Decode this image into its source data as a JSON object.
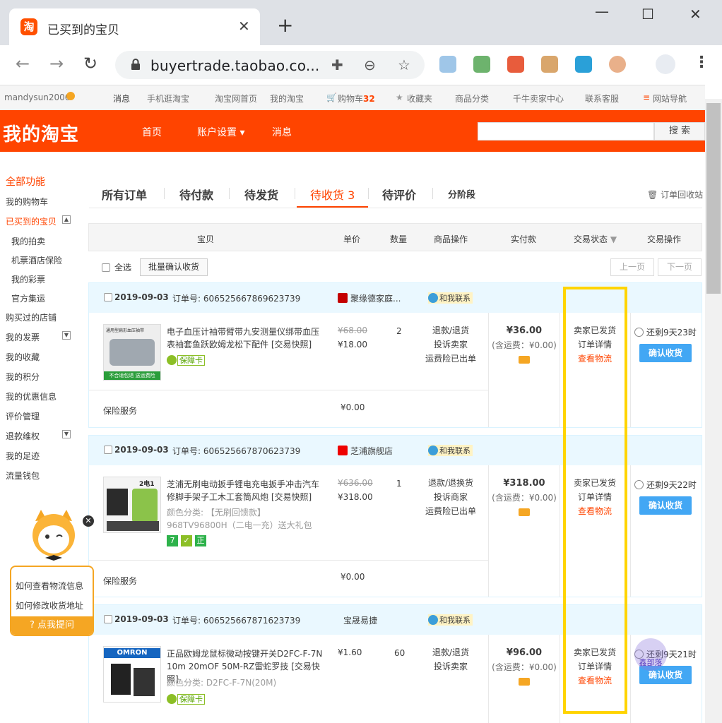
{
  "browser": {
    "tab_title": "已买到的宝贝",
    "favicon_text": "淘",
    "url": "buyertrade.taobao.co..."
  },
  "sitenav": {
    "user": "mandysun2006",
    "message": "消息",
    "mobile": "手机逛淘宝",
    "home": "淘宝网首页",
    "my": "我的淘宝",
    "cart": "购物车",
    "cart_count": "32",
    "fav": "收藏夹",
    "category": "商品分类",
    "seller": "千牛卖家中心",
    "service": "联系客服",
    "sitemap": "网站导航"
  },
  "header": {
    "logo": "我的淘宝",
    "nav": [
      "首页",
      "账户设置",
      "消息"
    ],
    "search_btn": "搜 索"
  },
  "sidebar": {
    "all": "全部功能",
    "cart": "我的购物车",
    "bought": "已买到的宝贝",
    "sub": [
      "我的拍卖",
      "机票酒店保险",
      "我的彩票",
      "官方集运"
    ],
    "items": [
      "购买过的店铺",
      "我的发票",
      "我的收藏",
      "我的积分",
      "我的优惠信息",
      "评价管理",
      "退款维权",
      "我的足迹",
      "流量钱包"
    ]
  },
  "tabs": {
    "all": "所有订单",
    "pay": "待付款",
    "ship": "待发货",
    "receive": "待收货",
    "receive_count": "3",
    "review": "待评价",
    "stage": "分阶段",
    "recycle": "订单回收站"
  },
  "columns": {
    "item": "宝贝",
    "price": "单价",
    "qty": "数量",
    "ops": "商品操作",
    "paid": "实付款",
    "status": "交易状态",
    "action": "交易操作"
  },
  "toolbar": {
    "select_all": "全选",
    "batch": "批量确认收货",
    "prev": "上一页",
    "next": "下一页"
  },
  "orders": [
    {
      "date": "2019-09-03",
      "order_no": "订单号: 606525667869623739",
      "shop": "聚缘德家庭...",
      "contact": "和我联系",
      "img_text": "通用型扁形血压袖带",
      "img_footer": "不合适包退 送运费险",
      "title": "电子血压计袖带臂带九安测量仪绑带血压表袖套鱼跃欧姆龙松下配件 [交易快照]",
      "attr": "",
      "badge": "保障卡",
      "orig_price": "¥68.00",
      "price": "¥18.00",
      "qty": "2",
      "ops": [
        "退款/退货",
        "投诉卖家",
        "运费险已出单"
      ],
      "paid": "¥36.00",
      "shipping": "(含运费：¥0.00)",
      "status": [
        "卖家已发货",
        "订单详情"
      ],
      "logistics": "查看物流",
      "remain": "还剩9天23时",
      "confirm": "确认收货",
      "insure": "保险服务",
      "insure_price": "¥0.00"
    },
    {
      "date": "2019-09-03",
      "order_no": "订单号: 606525667870623739",
      "shop": "芝浦旗舰店",
      "contact": "和我联系",
      "img_text": "2电1充",
      "img_footer": "",
      "title": "芝浦无刷电动扳手锂电充电扳手冲击汽车修脚手架子工木工套筒风炮 [交易快照]",
      "attr": "颜色分类: 【无刷回馈款】968TV96800H（二电一充）送大礼包",
      "badge": "",
      "badge_icons": [
        "7",
        "✓",
        "正"
      ],
      "orig_price": "¥636.00",
      "price": "¥318.00",
      "qty": "1",
      "ops": [
        "退款/退换货",
        "投诉商家",
        "运费险已出单"
      ],
      "paid": "¥318.00",
      "shipping": "(含运费：¥0.00)",
      "status": [
        "卖家已发货",
        "订单详情"
      ],
      "logistics": "查看物流",
      "remain": "还剩9天22时",
      "confirm": "确认收货",
      "insure": "保险服务",
      "insure_price": "¥0.00"
    },
    {
      "date": "2019-09-03",
      "order_no": "订单号: 606525667871623739",
      "shop": "宝晟易捷",
      "contact": "和我联系",
      "img_text": "OMRON",
      "img_footer": "",
      "title": "正品欧姆龙鼠标微动按键开关D2FC-F-7N 10m 20mOF 50M-RZ雷蛇罗技 [交易快照]",
      "attr": "颜色分类: D2FC-F-7N(20M)",
      "badge": "保障卡",
      "orig_price": "",
      "price": "¥1.60",
      "qty": "60",
      "ops": [
        "退款/退货",
        "投诉卖家"
      ],
      "paid": "¥96.00",
      "shipping": "(含运费：¥0.00)",
      "status": [
        "卖家已发货",
        "订单详情"
      ],
      "logistics": "查看物流",
      "remain": "还剩9天21时",
      "confirm": "确认收货"
    }
  ],
  "assistant": {
    "q1": "如何查看物流信息",
    "q2": "如何修改收货地址",
    "ask": "点我提问"
  },
  "watermark": "鑫部落",
  "colors": {
    "brand": "#ff4400",
    "highlight": "#ffd400",
    "confirm": "#42a7f4"
  }
}
